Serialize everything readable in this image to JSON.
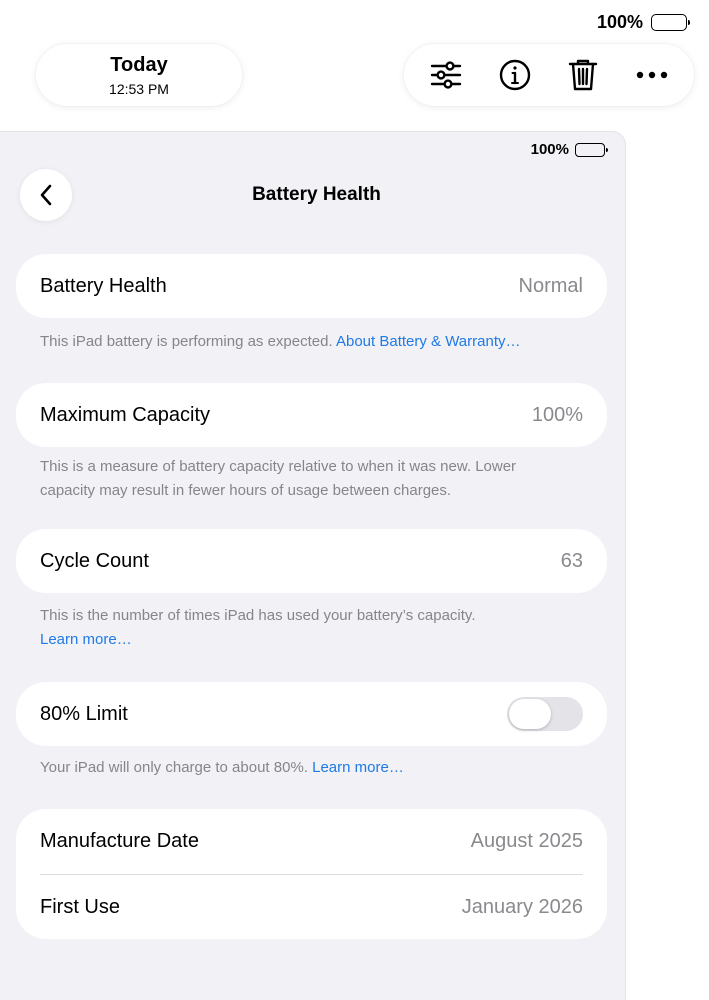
{
  "outer_status": {
    "battery_percent": "100%"
  },
  "header": {
    "title": "Today",
    "time": "12:53 PM"
  },
  "toolbar": {
    "icons": [
      "sliders-icon",
      "info-icon",
      "trash-icon",
      "more-icon"
    ]
  },
  "screen": {
    "status": {
      "battery_percent": "100%"
    },
    "nav": {
      "title": "Battery Health",
      "back_icon": "chevron-left-icon"
    },
    "battery_health": {
      "label": "Battery Health",
      "value": "Normal",
      "footnote": "This iPad battery is performing as expected.",
      "link": "About Battery & Warranty…"
    },
    "max_capacity": {
      "label": "Maximum Capacity",
      "value": "100%",
      "footnote_line1": "This is a measure of battery capacity relative to when it was new. Lower",
      "footnote_line2": "capacity may result in fewer hours of usage between charges."
    },
    "cycle_count": {
      "label": "Cycle Count",
      "value": "63",
      "footnote": "This is the number of times iPad has used your battery’s capacity.",
      "link": "Learn more…"
    },
    "limit": {
      "label": "80% Limit",
      "toggle_on": false,
      "footnote": "Your iPad will only charge to about 80%.",
      "link": "Learn more…"
    },
    "dates": {
      "manufacture_label": "Manufacture Date",
      "manufacture_value": "August 2025",
      "first_use_label": "First Use",
      "first_use_value": "January 2026"
    }
  },
  "colors": {
    "link": "#1f7ae6",
    "background": "#f1f1f6",
    "secondary_text": "#8a8a8e"
  }
}
